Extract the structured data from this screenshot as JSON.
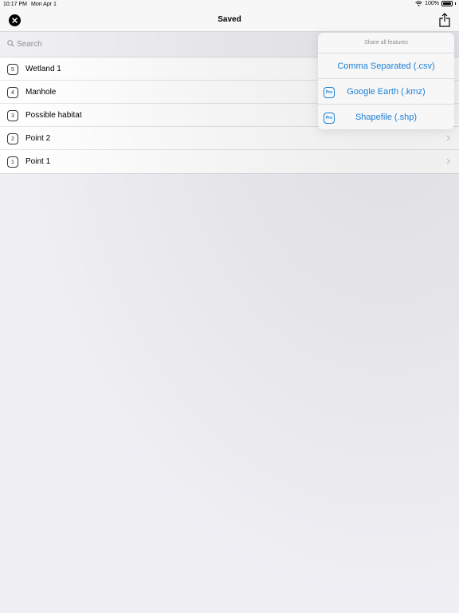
{
  "status_bar": {
    "time": "10:17 PM",
    "date": "Mon Apr 1",
    "battery": "100%"
  },
  "nav": {
    "title": "Saved"
  },
  "search": {
    "placeholder": "Search"
  },
  "list": {
    "items": [
      {
        "number": "5",
        "label": "Wetland 1"
      },
      {
        "number": "4",
        "label": "Manhole"
      },
      {
        "number": "3",
        "label": "Possible habitat"
      },
      {
        "number": "2",
        "label": "Point 2"
      },
      {
        "number": "1",
        "label": "Point 1"
      }
    ]
  },
  "popover": {
    "header": "Share all features",
    "options": [
      {
        "label": "Comma Separated (.csv)",
        "badge": ""
      },
      {
        "label": "Google Earth (.kmz)",
        "badge": "Pro"
      },
      {
        "label": "Shapefile (.shp)",
        "badge": "Pro"
      }
    ]
  },
  "colors": {
    "accent": "#1a7fd6",
    "background": "#efeff4"
  }
}
